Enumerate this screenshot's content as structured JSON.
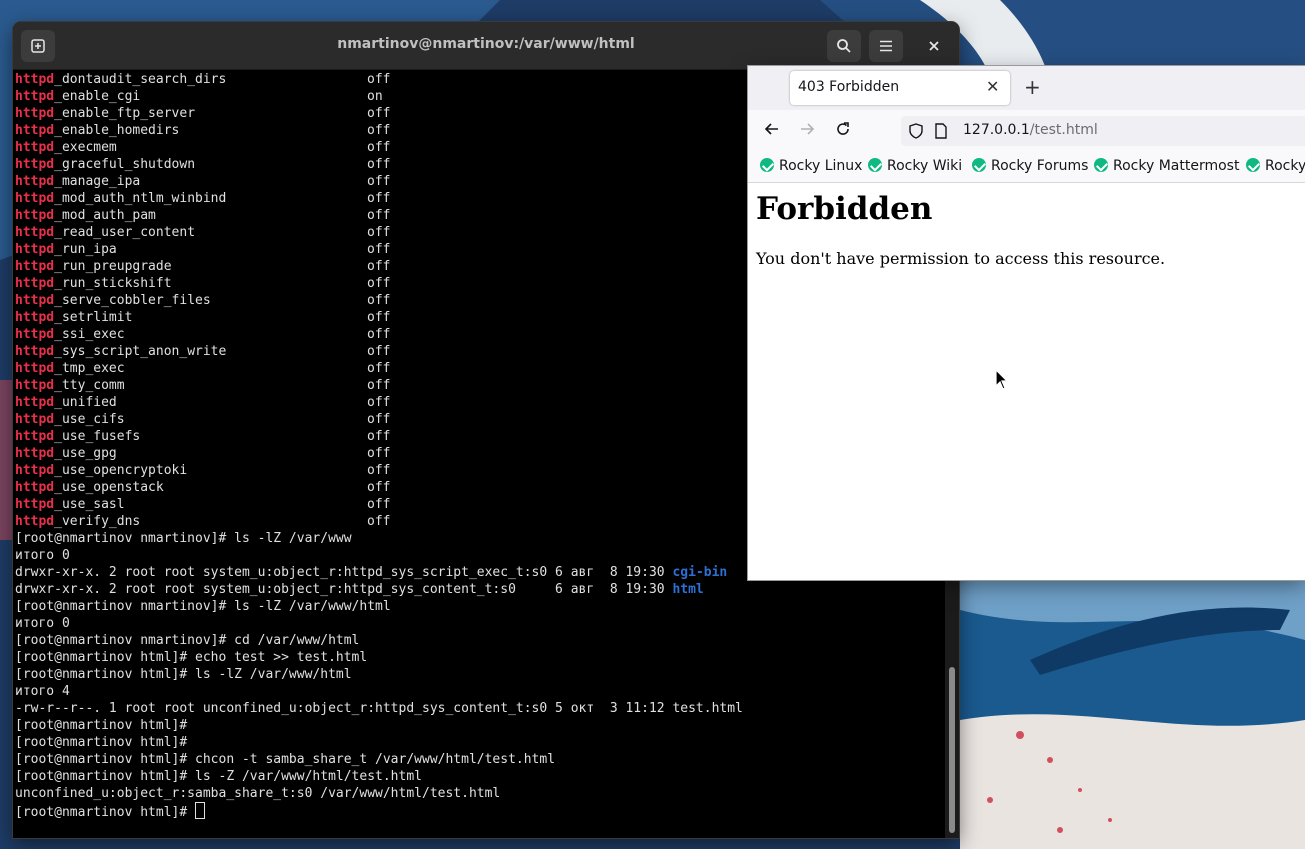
{
  "terminal": {
    "title": "nmartinov@nmartinov:/var/www/html",
    "bool_prefix": "httpd",
    "booleans": [
      {
        "name": "_dontaudit_search_dirs",
        "value": "off"
      },
      {
        "name": "_enable_cgi",
        "value": "on"
      },
      {
        "name": "_enable_ftp_server",
        "value": "off"
      },
      {
        "name": "_enable_homedirs",
        "value": "off"
      },
      {
        "name": "_execmem",
        "value": "off"
      },
      {
        "name": "_graceful_shutdown",
        "value": "off"
      },
      {
        "name": "_manage_ipa",
        "value": "off"
      },
      {
        "name": "_mod_auth_ntlm_winbind",
        "value": "off"
      },
      {
        "name": "_mod_auth_pam",
        "value": "off"
      },
      {
        "name": "_read_user_content",
        "value": "off"
      },
      {
        "name": "_run_ipa",
        "value": "off"
      },
      {
        "name": "_run_preupgrade",
        "value": "off"
      },
      {
        "name": "_run_stickshift",
        "value": "off"
      },
      {
        "name": "_serve_cobbler_files",
        "value": "off"
      },
      {
        "name": "_setrlimit",
        "value": "off"
      },
      {
        "name": "_ssi_exec",
        "value": "off"
      },
      {
        "name": "_sys_script_anon_write",
        "value": "off"
      },
      {
        "name": "_tmp_exec",
        "value": "off"
      },
      {
        "name": "_tty_comm",
        "value": "off"
      },
      {
        "name": "_unified",
        "value": "off"
      },
      {
        "name": "_use_cifs",
        "value": "off"
      },
      {
        "name": "_use_fusefs",
        "value": "off"
      },
      {
        "name": "_use_gpg",
        "value": "off"
      },
      {
        "name": "_use_opencryptoki",
        "value": "off"
      },
      {
        "name": "_use_openstack",
        "value": "off"
      },
      {
        "name": "_use_sasl",
        "value": "off"
      },
      {
        "name": "_verify_dns",
        "value": "off"
      }
    ],
    "lines": [
      {
        "text": "[root@nmartinov nmartinov]# ls -lZ /var/www"
      },
      {
        "text": "итого 0"
      },
      {
        "text": "drwxr-xr-x. 2 root root system_u:object_r:httpd_sys_script_exec_t:s0 6 авг  8 19:30 ",
        "dir": "cgi-bin"
      },
      {
        "text": "drwxr-xr-x. 2 root root system_u:object_r:httpd_sys_content_t:s0     6 авг  8 19:30 ",
        "dir": "html"
      },
      {
        "text": "[root@nmartinov nmartinov]# ls -lZ /var/www/html"
      },
      {
        "text": "итого 0"
      },
      {
        "text": "[root@nmartinov nmartinov]# cd /var/www/html"
      },
      {
        "text": "[root@nmartinov html]# echo test >> test.html"
      },
      {
        "text": "[root@nmartinov html]# ls -lZ /var/www/html"
      },
      {
        "text": "итого 4"
      },
      {
        "text": "-rw-r--r--. 1 root root unconfined_u:object_r:httpd_sys_content_t:s0 5 окт  3 11:12 test.html"
      },
      {
        "text": "[root@nmartinov html]#"
      },
      {
        "text": "[root@nmartinov html]#"
      },
      {
        "text": "[root@nmartinov html]# chcon -t samba_share_t /var/www/html/test.html"
      },
      {
        "text": "[root@nmartinov html]# ls -Z /var/www/html/test.html"
      },
      {
        "text": "unconfined_u:object_r:samba_share_t:s0 /var/www/html/test.html"
      }
    ],
    "prompt": "[root@nmartinov html]# "
  },
  "browser": {
    "tab_title": "403 Forbidden",
    "url_host": "127.0.0.1",
    "url_path": "/test.html",
    "bookmarks": [
      "Rocky Linux",
      "Rocky Wiki",
      "Rocky Forums",
      "Rocky Mattermost",
      "Rocky"
    ],
    "page_heading": "Forbidden",
    "page_text": "You don't have permission to access this resource."
  },
  "colors": {
    "keyword": "#e8304a",
    "directory": "#2d6fd4",
    "terminal_bg": "#000000",
    "bookmark_icon": "#10b981"
  },
  "icons": {
    "new_tab": "new-tab-icon",
    "search": "search-icon",
    "menu": "hamburger-menu-icon",
    "close": "close-icon",
    "back": "back-arrow-icon",
    "forward": "forward-arrow-icon",
    "reload": "reload-icon",
    "shield": "shield-icon",
    "page": "page-icon"
  }
}
